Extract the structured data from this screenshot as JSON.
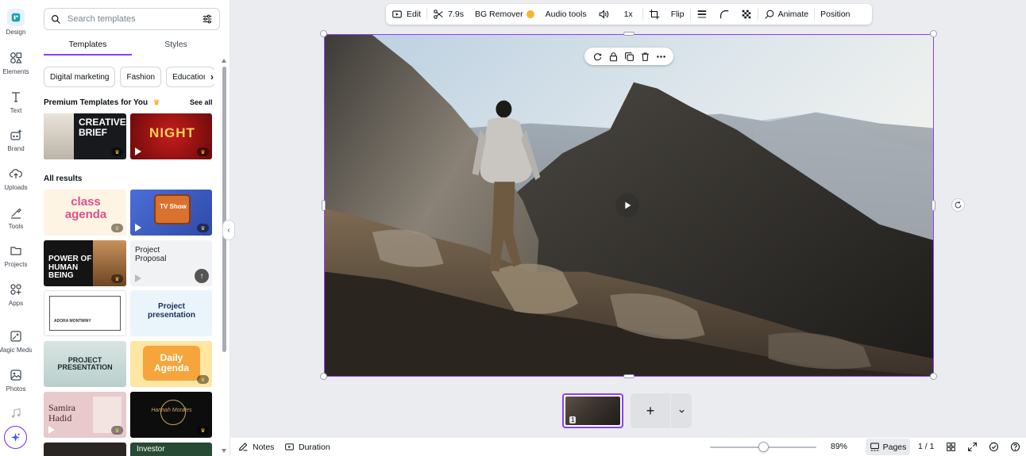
{
  "rail": {
    "items": [
      {
        "label": "Design",
        "icon": "design-icon"
      },
      {
        "label": "Elements",
        "icon": "elements-icon"
      },
      {
        "label": "Text",
        "icon": "text-icon"
      },
      {
        "label": "Brand",
        "icon": "brand-icon"
      },
      {
        "label": "Uploads",
        "icon": "uploads-icon"
      },
      {
        "label": "Tools",
        "icon": "tools-icon"
      },
      {
        "label": "Projects",
        "icon": "projects-icon"
      },
      {
        "label": "Apps",
        "icon": "apps-icon"
      },
      {
        "label": "Magic Media",
        "icon": "magic-media-icon"
      },
      {
        "label": "Photos",
        "icon": "photos-icon"
      }
    ]
  },
  "panel": {
    "search_placeholder": "Search templates",
    "tabs": [
      "Templates",
      "Styles"
    ],
    "chips": [
      "Digital marketing",
      "Fashion",
      "Education"
    ],
    "premium_title": "Premium Templates for You",
    "see_all": "See all",
    "all_results": "All results",
    "premium_thumbs": [
      {
        "text": "CREATIVE BRIEF"
      },
      {
        "text": "NIGHT"
      }
    ],
    "results": [
      {
        "text": "class agenda"
      },
      {
        "text": "TV Show"
      },
      {
        "text": "POWER OF HUMAN BEING"
      },
      {
        "text": "Project Proposal"
      },
      {
        "text": "ADORA MONTMINY"
      },
      {
        "text": "Project presentation"
      },
      {
        "text": "PROJECT PRESENTATION"
      },
      {
        "text": "Daily Agenda"
      },
      {
        "text": "Samira Hadid"
      },
      {
        "text": "Hannah Morales"
      },
      {
        "text": ""
      },
      {
        "text": "Investor"
      }
    ]
  },
  "toolbar": {
    "edit": "Edit",
    "duration": "7.9s",
    "bg_remover": "BG Remover",
    "audio_tools": "Audio tools",
    "speed": "1x",
    "flip": "Flip",
    "animate": "Animate",
    "position": "Position"
  },
  "pages": {
    "current_page_number": "1"
  },
  "bottombar": {
    "notes": "Notes",
    "duration": "Duration",
    "zoom": "89%",
    "zoom_level": 0.5,
    "pages": "Pages",
    "page_count": "1 / 1"
  },
  "colors": {
    "accent": "#8b3dff",
    "canvas_bg": "#ebecf0",
    "premium_gold": "#f5b52e"
  }
}
